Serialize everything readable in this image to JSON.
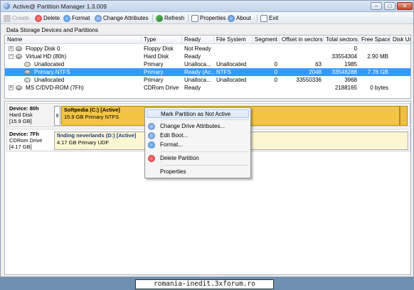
{
  "window": {
    "title": "Active@ Partition Manager 1.3.009",
    "minimize": "–",
    "maximize": "□",
    "close": "✕"
  },
  "toolbar": {
    "create": "Create",
    "delete": "Delete",
    "format": "Format",
    "change_attributes": "Change Attributes",
    "refresh": "Refresh",
    "properties": "Properties",
    "about": "About",
    "exit": "Exit"
  },
  "devices_panel": {
    "label": "Data Storage Devices and Partitions",
    "columns": [
      "Name",
      "Type",
      "Ready",
      "File System",
      "Segment",
      "Offset in sectors",
      "Total sectors",
      "Free Space",
      "Disk Usa"
    ],
    "rows": [
      {
        "name": "Floppy Disk 0",
        "type": "Floppy Disk",
        "ready": "Not Ready",
        "fs": "",
        "segment": "",
        "offset": "",
        "total": "0",
        "free": "",
        "usage": ""
      },
      {
        "name": "Virtual HD (80h)",
        "type": "Hard Disk",
        "ready": "Ready",
        "fs": "",
        "segment": "",
        "offset": "",
        "total": "33554304",
        "free": "2.90 MB",
        "usage": ""
      },
      {
        "name": "Unallocated",
        "type": "Primary",
        "ready": "Unalloca...",
        "fs": "Unallocated",
        "segment": "0",
        "offset": "63",
        "total": "1985",
        "free": "",
        "usage": ""
      },
      {
        "name": "Primary NTFS",
        "type": "Primary",
        "ready": "Ready (Ac...",
        "fs": "NTFS",
        "segment": "0",
        "offset": "2048",
        "total": "33548288",
        "free": "7.76 GB",
        "usage": ""
      },
      {
        "name": "Unallocated",
        "type": "Primary",
        "ready": "Unalloca...",
        "fs": "Unallocated",
        "segment": "0",
        "offset": "33550336",
        "total": "3968",
        "free": "",
        "usage": ""
      },
      {
        "name": "MS C/DVD-ROM (7Fh)",
        "type": "CDRom Drive",
        "ready": "Ready",
        "fs": "",
        "segment": "",
        "offset": "",
        "total": "2188165",
        "free": "0 bytes",
        "usage": ""
      }
    ]
  },
  "disk_map": {
    "devices": [
      {
        "header": "Device: 80h",
        "kind": "Hard Disk",
        "size": "[15.9 GB]",
        "small_label": "9",
        "partition_title": "Softpedia (C:) [Active]",
        "partition_sub": "15.9 GB Primary NTFS"
      },
      {
        "header": "Device: 7Fh",
        "kind": "CDRom Drive",
        "size": "[4.17 GB]",
        "partition_title": "finding neverlands (D:) [Active]",
        "partition_sub": "4.17 GB Primary UDF"
      }
    ]
  },
  "context_menu": {
    "mark_not_active": "Mark Partition as Not Active",
    "change_drive_attributes": "Change Drive Attributes...",
    "edit_boot": "Edit Boot...",
    "format": "Format...",
    "delete_partition": "Delete Partition",
    "properties": "Properties"
  },
  "footer": {
    "watermark": "romania-inedit.3xforum.ro"
  },
  "colors": {
    "selection": "#3399ff",
    "partition_fill": "#f4c542",
    "cd_fill": "#fdf6d2"
  }
}
